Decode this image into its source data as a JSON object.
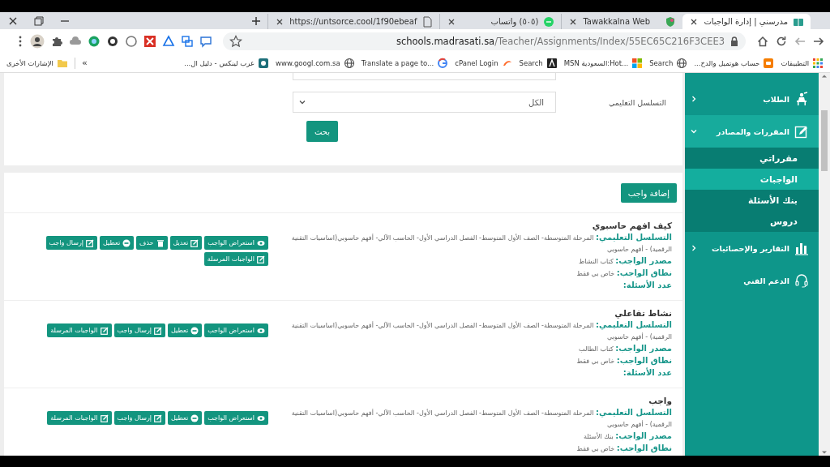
{
  "tabs": [
    {
      "title": "مدرسني | إدارة الواجبات",
      "kind": "school",
      "selected": true
    },
    {
      "title": "Tawakkalna Web",
      "kind": "shield",
      "selected": false
    },
    {
      "title": "(٥٠٥) واتساب",
      "kind": "chat",
      "selected": false
    },
    {
      "title": "https://untsorce.cool/1f90ebeaf",
      "kind": "document",
      "selected": false
    }
  ],
  "address_bar": {
    "host": "schools.madrasati.sa",
    "path": "/Teacher/Assignments/Index/55EC65C216F3CEE3"
  },
  "bookmarks": [
    {
      "label": "التطبيقات",
      "kind": "grid"
    },
    {
      "label": "حساب هوتميل والدخ...",
      "kind": "orange"
    },
    {
      "label": "Search",
      "kind": "globe"
    },
    {
      "label": "MSN السعودية:Hot...",
      "kind": "tiles"
    },
    {
      "label": "Search",
      "kind": "dark"
    },
    {
      "label": "cPanel Login",
      "kind": "cpanel"
    },
    {
      "label": "Translate a page to...",
      "kind": "google"
    },
    {
      "label": "www.googl.com.sa",
      "kind": "globe"
    },
    {
      "label": "عرب لينكس - دليل ال...",
      "kind": "teal"
    }
  ],
  "bookmarks_overflow": "»",
  "other_bookmarks": "الإشارات الأخرى",
  "filter": {
    "label": "التسلسل التعليمي",
    "value": "الكل",
    "button": "بحث"
  },
  "add_button": "إضافة واجب",
  "assignments": [
    {
      "title": "كيف افهم حاسبوي",
      "fields": [
        {
          "label": "التسلسل التعليمي:",
          "value": "المرحلة المتوسطة- الصف الأول المتوسط- الفصل الدراسي الأول- الحاسب الآلي- أفهم حاسوبي(اساسيات التقنية الرقمية) - أفهم حاسوبي"
        },
        {
          "label": "مصدر الواجب:",
          "value": "كتاب النشاط"
        },
        {
          "label": "نطاق الواجب:",
          "value": "خاص بي فقط"
        },
        {
          "label": "عدد الأسئلة:"
        }
      ],
      "buttons": [
        {
          "label": "استعراض الواجب",
          "kind": "view"
        },
        {
          "label": "تعديل",
          "kind": "edit"
        },
        {
          "label": "حذف",
          "kind": "delete"
        },
        {
          "label": "تعطيل",
          "kind": "disable"
        },
        {
          "label": "إرسال واجب",
          "kind": "send"
        },
        {
          "label": "الواجبات المرسلة",
          "kind": "sent"
        }
      ]
    },
    {
      "title": "نشاط تفاعلي",
      "fields": [
        {
          "label": "التسلسل التعليمي:",
          "value": "المرحلة المتوسطة- الصف الأول المتوسط- الفصل الدراسي الأول- الحاسب الآلي- أفهم حاسوبي(اساسيات التقنية الرقمية) - أفهم حاسوبي"
        },
        {
          "label": "مصدر الواجب:",
          "value": "كتاب الطالب"
        },
        {
          "label": "نطاق الواجب:",
          "value": "خاص بي فقط"
        },
        {
          "label": "عدد الأسئلة:"
        }
      ],
      "buttons": [
        {
          "label": "استعراض الواجب",
          "kind": "view"
        },
        {
          "label": "تعطيل",
          "kind": "disable"
        },
        {
          "label": "إرسال واجب",
          "kind": "send"
        },
        {
          "label": "الواجبات المرسلة",
          "kind": "sent"
        }
      ]
    },
    {
      "title": "واجب",
      "fields": [
        {
          "label": "التسلسل التعليمي:",
          "value": "المرحلة المتوسطة- الصف الأول المتوسط- الفصل الدراسي الأول- الحاسب الآلي- أفهم حاسوبي(اساسيات التقنية الرقمية) - أفهم حاسوبي"
        },
        {
          "label": "مصدر الواجب:",
          "value": "بنك الأسئلة"
        },
        {
          "label": "نطاق الواجب:",
          "value": "خاص بي فقط"
        }
      ],
      "buttons": [
        {
          "label": "استعراض الواجب",
          "kind": "view"
        },
        {
          "label": "تعطيل",
          "kind": "disable"
        },
        {
          "label": "إرسال واجب",
          "kind": "send"
        },
        {
          "label": "الواجبات المرسلة",
          "kind": "sent"
        }
      ]
    }
  ],
  "sidebar": {
    "items": [
      {
        "label": "الطلاب",
        "kind": "students",
        "expanded": false
      },
      {
        "label": "المقررات والمصادر",
        "kind": "courses",
        "expanded": true,
        "children": [
          {
            "label": "مقرراتي",
            "selected": false
          },
          {
            "label": "الواجبات",
            "selected": true
          },
          {
            "label": "بنك الأسئلة",
            "selected": false
          },
          {
            "label": "دروس",
            "selected": false
          }
        ]
      },
      {
        "label": "التقارير والإحصائيات",
        "kind": "reports",
        "expanded": false
      },
      {
        "label": "الدعم الفني",
        "kind": "support"
      }
    ]
  }
}
